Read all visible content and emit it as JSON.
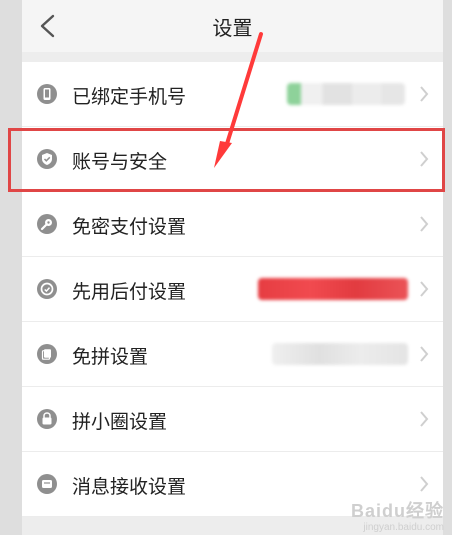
{
  "header": {
    "title": "设置"
  },
  "settings": {
    "items": [
      {
        "label": "已绑定手机号",
        "icon": "phone-icon",
        "value": ""
      },
      {
        "label": "账号与安全",
        "icon": "shield-check-icon"
      },
      {
        "label": "免密支付设置",
        "icon": "key-icon"
      },
      {
        "label": "先用后付设置",
        "icon": "badge-icon",
        "value": ""
      },
      {
        "label": "免拼设置",
        "icon": "copy-icon",
        "value": ""
      },
      {
        "label": "拼小圈设置",
        "icon": "lock-icon"
      },
      {
        "label": "消息接收设置",
        "icon": "message-icon"
      }
    ]
  },
  "watermark": {
    "main": "Baidu经验",
    "sub": "jingyan.baidu.com"
  }
}
